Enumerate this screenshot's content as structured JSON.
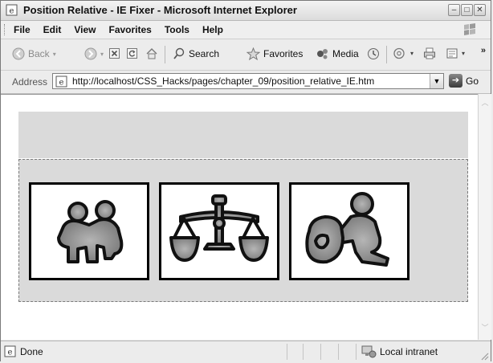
{
  "window": {
    "title": "Position Relative - IE Fixer - Microsoft Internet Explorer"
  },
  "menu": {
    "items": [
      "File",
      "Edit",
      "View",
      "Favorites",
      "Tools",
      "Help"
    ]
  },
  "toolbar": {
    "back_label": "Back",
    "search_label": "Search",
    "favorites_label": "Favorites",
    "media_label": "Media"
  },
  "address": {
    "label": "Address",
    "value": "http://localhost/CSS_Hacks/pages/chapter_09/position_relative_IE.htm",
    "go_label": "Go"
  },
  "content": {
    "tiles": [
      {
        "icon": "gemini-zodiac-icon"
      },
      {
        "icon": "libra-zodiac-icon"
      },
      {
        "icon": "aquarius-zodiac-icon"
      }
    ]
  },
  "status": {
    "text": "Done",
    "zone": "Local intranet"
  }
}
